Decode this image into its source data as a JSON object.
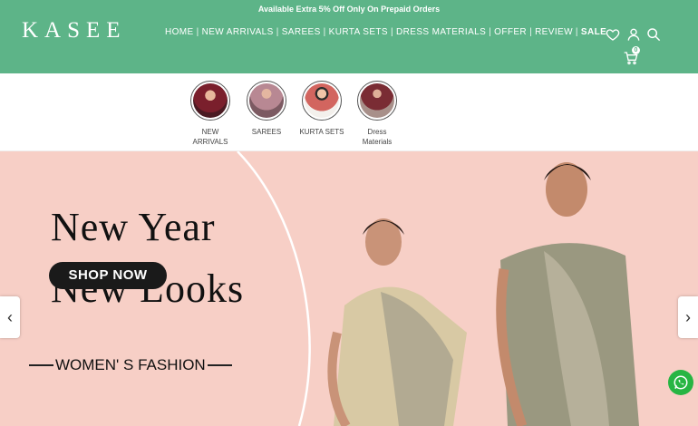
{
  "header": {
    "announcement": "Available Extra 5% Off Only On Prepaid Orders",
    "logo": "KASEE",
    "nav": [
      {
        "label": "HOME"
      },
      {
        "label": "NEW ARRIVALS"
      },
      {
        "label": "SAREES"
      },
      {
        "label": "KURTA SETS"
      },
      {
        "label": "DRESS MATERIALS"
      },
      {
        "label": "OFFER"
      },
      {
        "label": "REVIEW"
      },
      {
        "label": "SALE"
      }
    ],
    "icons": [
      "heart-icon",
      "user-icon",
      "search-icon",
      "cart-icon"
    ],
    "cart_count": "0",
    "bg_color": "#5db488"
  },
  "categories": [
    {
      "line1": "NEW",
      "line2": "ARRIVALS",
      "color": "#8c2b3a"
    },
    {
      "line1": "SAREES",
      "line2": "",
      "color": "#a77a83"
    },
    {
      "line1": "KURTA SETS",
      "line2": "",
      "color": "#c9605c"
    },
    {
      "line1": "Dress",
      "line2": "Materials",
      "color": "#7a3238"
    }
  ],
  "hero": {
    "title_line1": "New  Year",
    "title_line2": "New Looks",
    "subtitle": "WOMEN' S FASHION",
    "button": "SHOP NOW",
    "bg_color": "#f7cfc6"
  },
  "carousel": {
    "prev": "‹",
    "next": "›"
  },
  "whatsapp_icon": "whatsapp-icon"
}
